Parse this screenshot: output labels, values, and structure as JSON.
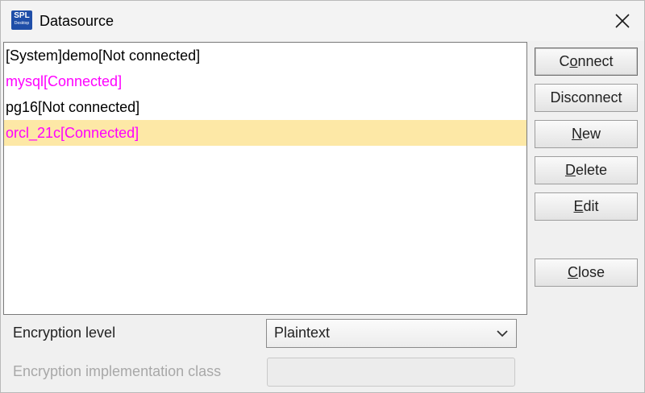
{
  "window": {
    "title": "Datasource",
    "icon_text": "SPL",
    "icon_subtext": "Desktop"
  },
  "datasources": [
    {
      "label": "[System]demo[Not connected]",
      "connected": false,
      "selected": false
    },
    {
      "label": "mysql[Connected]",
      "connected": true,
      "selected": false
    },
    {
      "label": "pg16[Not connected]",
      "connected": false,
      "selected": false
    },
    {
      "label": "orcl_21c[Connected]",
      "connected": true,
      "selected": true
    }
  ],
  "buttons": {
    "connect": {
      "pre": "C",
      "acc": "o",
      "post": "nnect"
    },
    "disconnect": {
      "pre": "Disconnect",
      "acc": "",
      "post": ""
    },
    "new": {
      "pre": "",
      "acc": "N",
      "post": "ew"
    },
    "delete": {
      "pre": "",
      "acc": "D",
      "post": "elete"
    },
    "edit": {
      "pre": "",
      "acc": "E",
      "post": "dit"
    },
    "close": {
      "pre": "",
      "acc": "C",
      "post": "lose"
    }
  },
  "form": {
    "encryption_level_label": "Encryption level",
    "encryption_level_value": "Plaintext",
    "encryption_class_label": "Encryption implementation class",
    "encryption_class_value": ""
  },
  "colors": {
    "connected_text": "#ff00ff",
    "selected_row": "#fde8a6",
    "disabled_text": "#a8a8a8"
  }
}
